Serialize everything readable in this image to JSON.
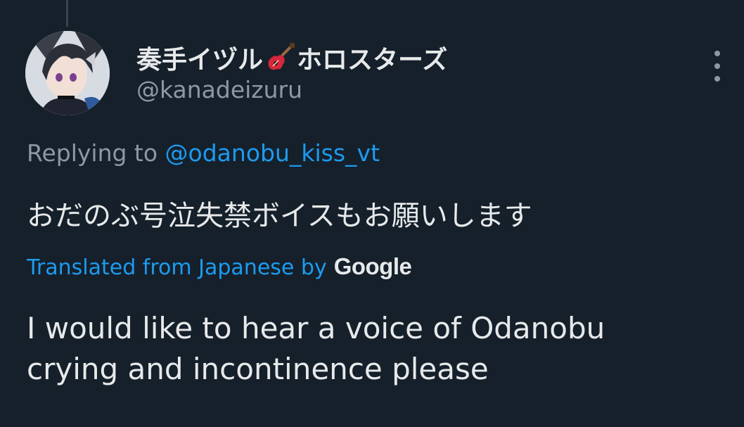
{
  "tweet": {
    "display_name_before": "奏手イヅル",
    "display_name_icon": "guitar-icon",
    "display_name_after": "ホロスターズ",
    "handle": "@kanadeizuru",
    "replying_prefix": "Replying to ",
    "replying_mention": "@odanobu_kiss_vt",
    "original_text": "おだのぶ号泣失禁ボイスもお願いします",
    "translated_label": "Translated from Japanese by",
    "translator_brand": "Google",
    "translation_text": "I would like to hear a voice of Odanobu crying and incontinence please",
    "more_icon": "more-vertical-icon"
  },
  "colors": {
    "background": "#15202b",
    "primary_text": "#e7e9ea",
    "secondary_text": "#8b98a5",
    "accent": "#1d9bf0"
  }
}
